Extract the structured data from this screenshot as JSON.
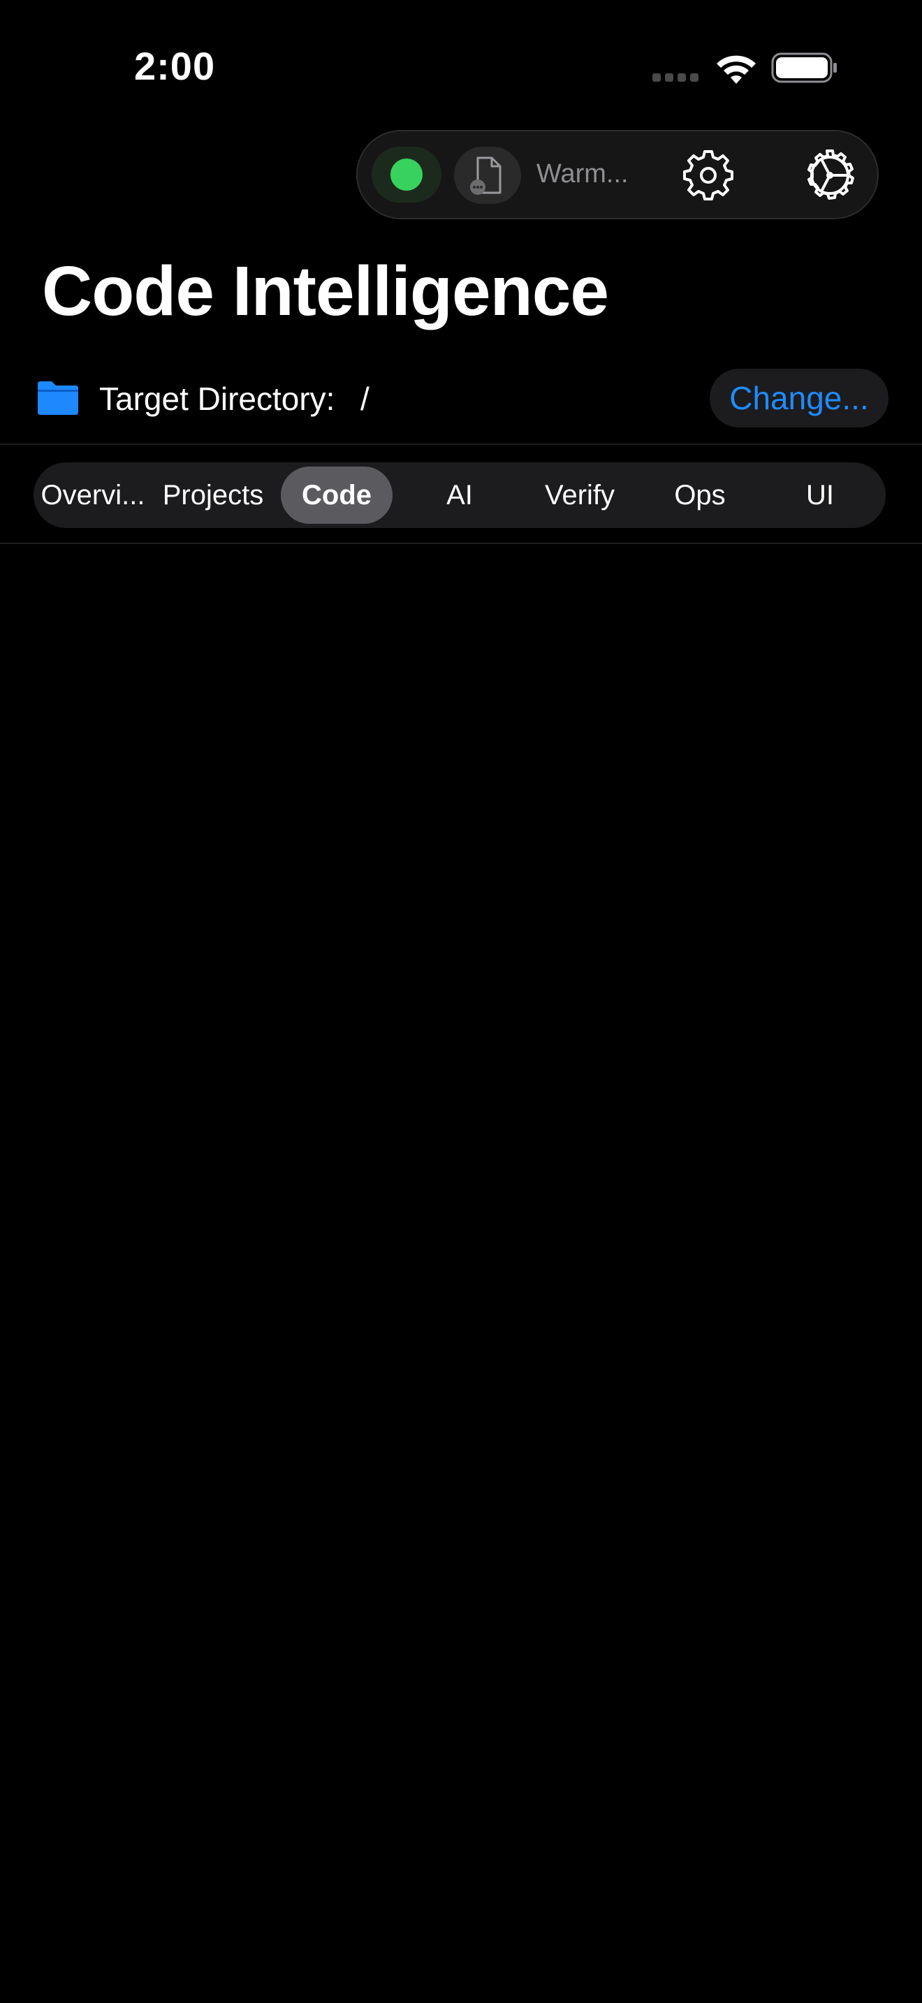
{
  "status_bar": {
    "time": "2:00"
  },
  "toolbar": {
    "status_color": "#37d25e",
    "warm_label": "Warm...",
    "icons": [
      "status-dot",
      "document-icon",
      "gear-icon",
      "gear-play-icon"
    ]
  },
  "page": {
    "title": "Code Intelligence"
  },
  "target_directory": {
    "label": "Target Directory:",
    "value": "/",
    "change_label": "Change..."
  },
  "tabs": [
    {
      "label": "Overvi..."
    },
    {
      "label": "Projects"
    },
    {
      "label": "Code",
      "selected": true
    },
    {
      "label": "AI"
    },
    {
      "label": "Verify"
    },
    {
      "label": "Ops"
    },
    {
      "label": "UI"
    }
  ],
  "colors": {
    "accent": "#1f8bff",
    "background": "#000000",
    "selected_tab": "#5b5b5f"
  }
}
